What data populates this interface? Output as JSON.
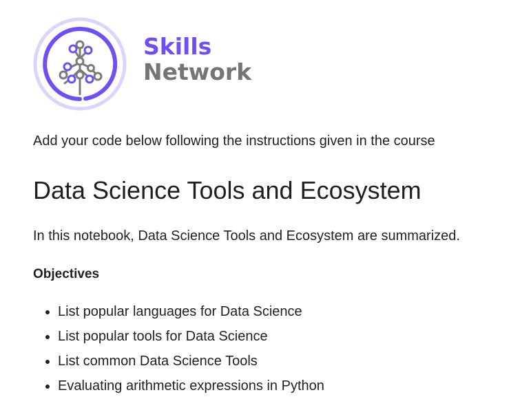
{
  "logo": {
    "line1": "Skills",
    "line2": "Network",
    "mark_icon": "tree-network-icon",
    "colors": {
      "purple": "#6f4ff0",
      "light_purple": "#ddd4fb",
      "gray": "#737679"
    }
  },
  "instruction": "Add your code below following the instructions given in the course",
  "title": "Data Science Tools and Ecosystem",
  "summary": "In this notebook, Data Science Tools and Ecosystem are summarized.",
  "objectives": {
    "heading": "Objectives",
    "items": [
      "List popular languages for Data Science",
      "List popular tools for Data Science",
      "List common Data Science Tools",
      "Evaluating arithmetic expressions in Python"
    ]
  }
}
